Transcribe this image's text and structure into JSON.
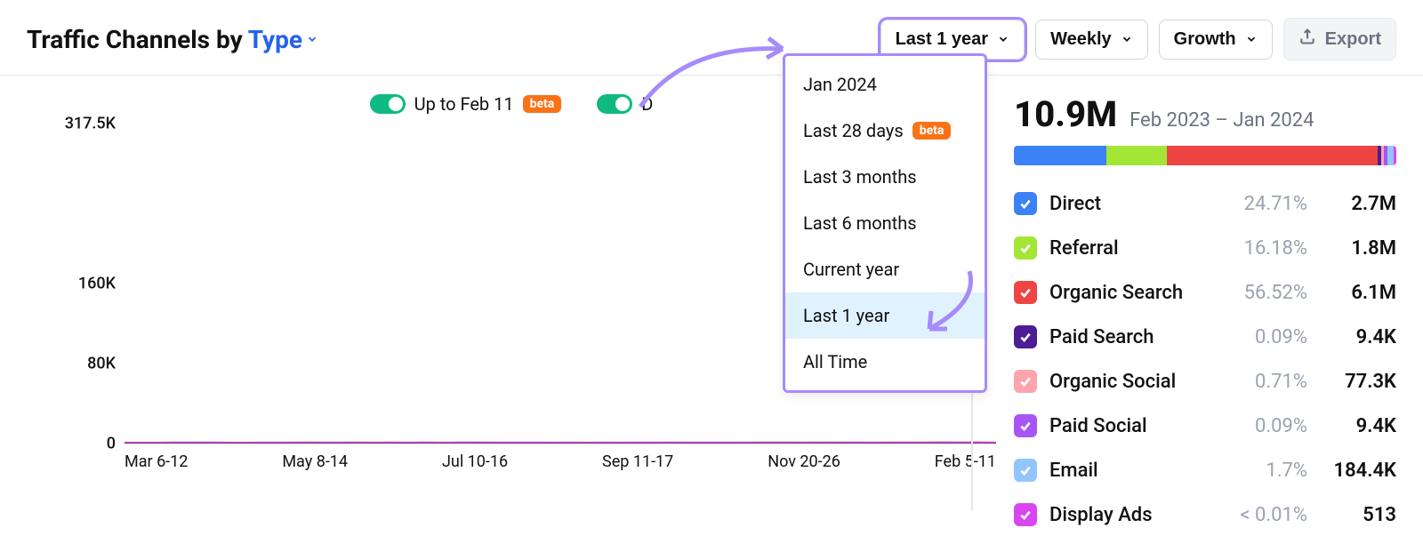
{
  "header": {
    "title_prefix": "Traffic Channels by ",
    "type_label": "Type",
    "timerange_label": "Last 1 year",
    "interval_label": "Weekly",
    "metric_label": "Growth",
    "export_label": "Export"
  },
  "toggles": {
    "uptodate_label": "Up to Feb 11",
    "uptodate_badge": "beta",
    "second_label": "D"
  },
  "dropdown": {
    "items": [
      {
        "label": "Jan 2024"
      },
      {
        "label": "Last 28 days",
        "badge": "beta"
      },
      {
        "label": "Last 3 months"
      },
      {
        "label": "Last 6 months"
      },
      {
        "label": "Current year"
      },
      {
        "label": "Last 1 year",
        "selected": true
      },
      {
        "label": "All Time"
      }
    ]
  },
  "summary": {
    "total": "10.9M",
    "range": "Feb 2023 – Jan 2024"
  },
  "legend": [
    {
      "name": "Direct",
      "pct": "24.71%",
      "value": "2.7M",
      "color": "#3b82f6"
    },
    {
      "name": "Referral",
      "pct": "16.18%",
      "value": "1.8M",
      "color": "#a3e635"
    },
    {
      "name": "Organic Search",
      "pct": "56.52%",
      "value": "6.1M",
      "color": "#ef4444"
    },
    {
      "name": "Paid Search",
      "pct": "0.09%",
      "value": "9.4K",
      "color": "#4c1d95"
    },
    {
      "name": "Organic Social",
      "pct": "0.71%",
      "value": "77.3K",
      "color": "#fda4af"
    },
    {
      "name": "Paid Social",
      "pct": "0.09%",
      "value": "9.4K",
      "color": "#a855f7"
    },
    {
      "name": "Email",
      "pct": "1.7%",
      "value": "184.4K",
      "color": "#93c5fd"
    },
    {
      "name": "Display Ads",
      "pct": "< 0.01%",
      "value": "513",
      "color": "#d946ef"
    }
  ],
  "chart_data": {
    "type": "line",
    "ylabel": "",
    "xlabel": "",
    "ylim": [
      0,
      317500
    ],
    "y_ticks": [
      "317.5K",
      "160K",
      "80K",
      "0"
    ],
    "x_ticks": [
      "Mar 6-12",
      "May 8-14",
      "Jul 10-16",
      "Sep 11-17",
      "Nov 20-26",
      "Feb 5-11"
    ],
    "series": [
      {
        "name": "Organic Search",
        "color": "#ef4444",
        "values": [
          58,
          64,
          120,
          250,
          70,
          230,
          70,
          120,
          90,
          80,
          150,
          200,
          60,
          140,
          90,
          225,
          80,
          200,
          60,
          210,
          140,
          70,
          120,
          120,
          40,
          70,
          70,
          90,
          95,
          80,
          80,
          180,
          100,
          130,
          100,
          60,
          260,
          240,
          90,
          270,
          80,
          220,
          70,
          180,
          240,
          280,
          310,
          280,
          310,
          120
        ]
      },
      {
        "name": "Direct",
        "color": "#3b82f6",
        "values": [
          20,
          16,
          30,
          65,
          200,
          50,
          40,
          20,
          80,
          100,
          70,
          20,
          80,
          60,
          30,
          20,
          40,
          80,
          30,
          180,
          60,
          120,
          60,
          60,
          50,
          130,
          40,
          60,
          30,
          60,
          60,
          30,
          75,
          50,
          130,
          80,
          60,
          120,
          90,
          70,
          160,
          60,
          16,
          50,
          40,
          50,
          70,
          110,
          26,
          30
        ]
      },
      {
        "name": "Referral",
        "color": "#a3e635",
        "values": [
          3,
          3,
          3,
          3,
          6,
          3,
          3,
          3,
          3,
          3,
          3,
          3,
          3,
          3,
          100,
          26,
          20,
          3,
          3,
          3,
          3,
          40,
          3,
          3,
          3,
          3,
          3,
          3,
          6,
          3,
          3,
          3,
          3,
          3,
          3,
          160,
          46,
          60,
          73,
          26,
          140,
          40,
          46,
          73,
          40,
          100,
          20,
          3,
          3,
          3
        ]
      },
      {
        "name": "Email",
        "color": "#93c5fd",
        "values": [
          6,
          6,
          6,
          20,
          46,
          20,
          3,
          3,
          3,
          6,
          6,
          6,
          30,
          6,
          6,
          6,
          6,
          6,
          6,
          6,
          6,
          6,
          6,
          6,
          6,
          6,
          6,
          6,
          6,
          6,
          6,
          6,
          6,
          6,
          6,
          6,
          6,
          6,
          6,
          6,
          6,
          6,
          6,
          6,
          6,
          6,
          6,
          6,
          6,
          6
        ]
      },
      {
        "name": "Organic Social",
        "color": "#fda4af",
        "values": [
          2,
          2,
          2,
          2,
          2,
          2,
          2,
          2,
          2,
          2,
          2,
          2,
          2,
          2,
          2,
          2,
          2,
          2,
          2,
          2,
          2,
          2,
          2,
          2,
          2,
          2,
          2,
          2,
          2,
          2,
          2,
          2,
          2,
          2,
          2,
          2,
          2,
          2,
          20,
          10,
          2,
          2,
          2,
          2,
          2,
          2,
          2,
          2,
          2,
          2
        ]
      },
      {
        "name": "Display Ads",
        "color": "#d946ef",
        "values": [
          1,
          1,
          1,
          1,
          1,
          1,
          1,
          1,
          1,
          1,
          1,
          1,
          1,
          1,
          1,
          1,
          1,
          1,
          1,
          1,
          1,
          1,
          1,
          1,
          1,
          1,
          1,
          1,
          1,
          1,
          1,
          1,
          1,
          1,
          1,
          1,
          1,
          1,
          1,
          1,
          1,
          1,
          1,
          1,
          1,
          1,
          1,
          1,
          1,
          1
        ]
      }
    ]
  }
}
